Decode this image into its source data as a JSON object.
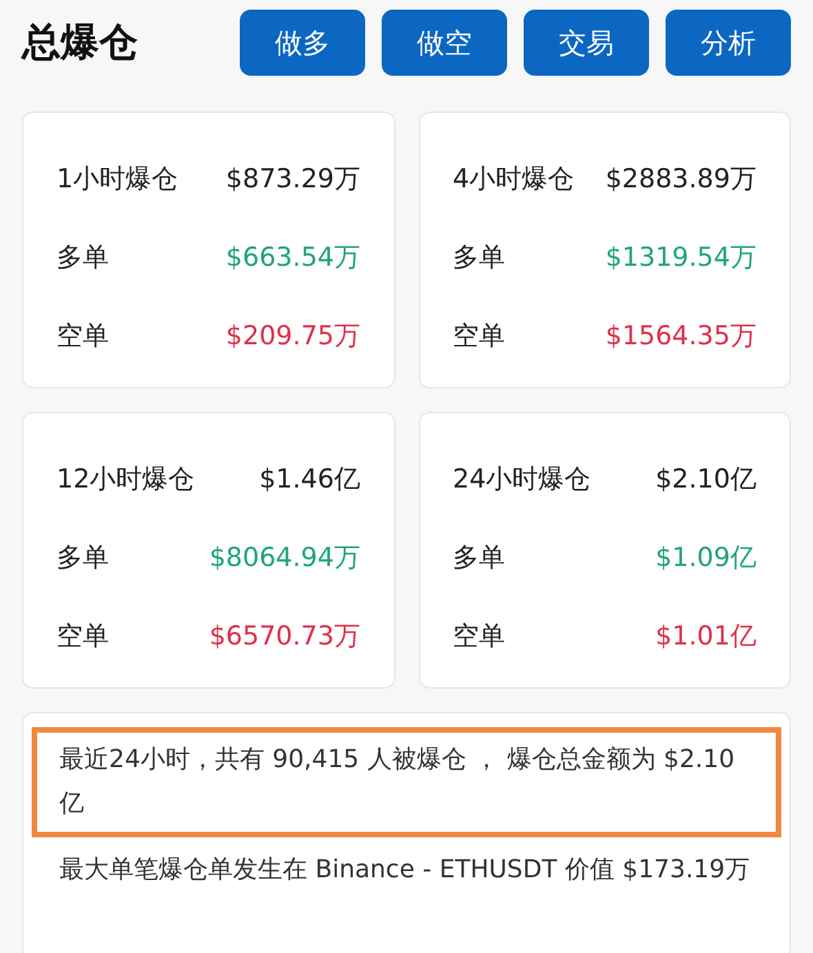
{
  "header": {
    "title": "总爆仓",
    "buttons": [
      "做多",
      "做空",
      "交易",
      "分析"
    ]
  },
  "cards": [
    {
      "rows": [
        {
          "kind": "total",
          "label": "1小时爆仓",
          "value": "$873.29万"
        },
        {
          "kind": "long",
          "label": "多单",
          "value": "$663.54万"
        },
        {
          "kind": "short",
          "label": "空单",
          "value": "$209.75万"
        }
      ]
    },
    {
      "rows": [
        {
          "kind": "total",
          "label": "4小时爆仓",
          "value": "$2883.89万"
        },
        {
          "kind": "long",
          "label": "多单",
          "value": "$1319.54万"
        },
        {
          "kind": "short",
          "label": "空单",
          "value": "$1564.35万"
        }
      ]
    },
    {
      "rows": [
        {
          "kind": "total",
          "label": "12小时爆仓",
          "value": "$1.46亿"
        },
        {
          "kind": "long",
          "label": "多单",
          "value": "$8064.94万"
        },
        {
          "kind": "short",
          "label": "空单",
          "value": "$6570.73万"
        }
      ]
    },
    {
      "rows": [
        {
          "kind": "total",
          "label": "24小时爆仓",
          "value": "$2.10亿"
        },
        {
          "kind": "long",
          "label": "多单",
          "value": "$1.09亿"
        },
        {
          "kind": "short",
          "label": "空单",
          "value": "$1.01亿"
        }
      ]
    }
  ],
  "summary": {
    "lines": [
      {
        "text": "最近24小时，共有 90,415 人被爆仓 ， 爆仓总金额为 $2.10 亿",
        "highlighted": true
      },
      {
        "text": "最大单笔爆仓单发生在 Binance - ETHUSDT 价值 $173.19万",
        "highlighted": false
      }
    ]
  }
}
